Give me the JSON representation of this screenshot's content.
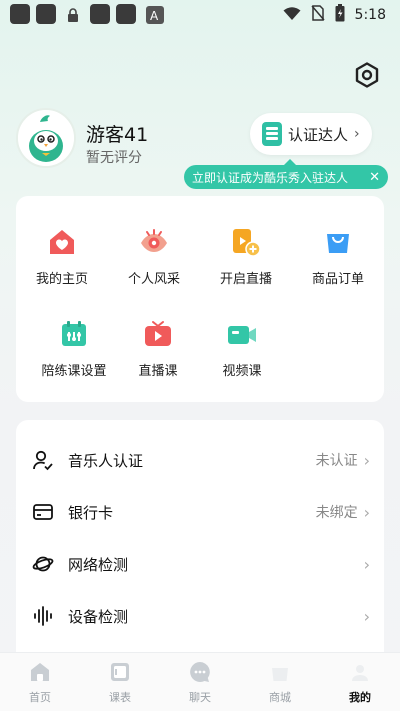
{
  "status_bar": {
    "time": "5:18"
  },
  "profile": {
    "username": "游客41",
    "rating": "暂无评分"
  },
  "verify": {
    "label": "认证达人",
    "tip": "立即认证成为酷乐秀入驻达人"
  },
  "grid": [
    {
      "label": "我的主页",
      "icon": "home-heart-icon",
      "color": "#f05a5a"
    },
    {
      "label": "个人风采",
      "icon": "eye-icon",
      "color": "#f07a62"
    },
    {
      "label": "开启直播",
      "icon": "live-start-icon",
      "color": "#f5a623"
    },
    {
      "label": "商品订单",
      "icon": "shopping-bag-icon",
      "color": "#3b9df5"
    },
    {
      "label": "陪练课设置",
      "icon": "calendar-settings-icon",
      "color": "#33c6a7"
    },
    {
      "label": "直播课",
      "icon": "tv-play-icon",
      "color": "#f05a5a"
    },
    {
      "label": "视频课",
      "icon": "video-camera-icon",
      "color": "#33c6a7"
    }
  ],
  "list": [
    {
      "label": "音乐人认证",
      "status": "未认证",
      "icon": "user-check-icon"
    },
    {
      "label": "银行卡",
      "status": "未绑定",
      "icon": "bank-card-icon"
    },
    {
      "label": "网络检测",
      "status": "",
      "icon": "planet-icon"
    },
    {
      "label": "设备检测",
      "status": "",
      "icon": "sound-wave-icon"
    }
  ],
  "nav": [
    {
      "label": "首页",
      "icon": "home-icon",
      "active": false
    },
    {
      "label": "课表",
      "icon": "schedule-icon",
      "active": false
    },
    {
      "label": "聊天",
      "icon": "chat-icon",
      "active": false
    },
    {
      "label": "商城",
      "icon": "mall-icon",
      "active": false
    },
    {
      "label": "我的",
      "icon": "me-icon",
      "active": true
    }
  ],
  "colors": {
    "accent": "#33c6a7"
  }
}
